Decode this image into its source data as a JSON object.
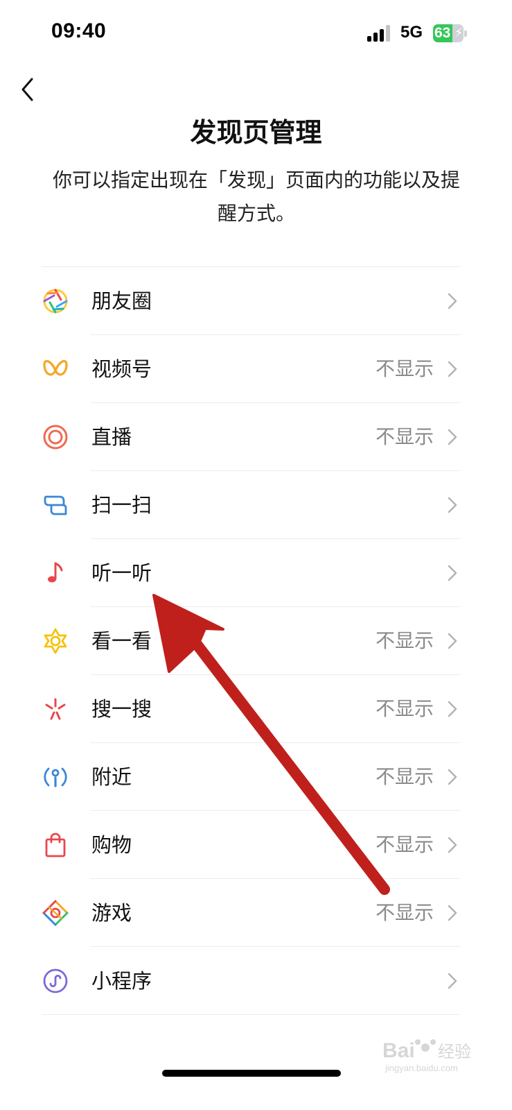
{
  "status_bar": {
    "time": "09:40",
    "network": "5G",
    "battery": "63",
    "battery_level": 0.63
  },
  "header": {
    "title": "发现页管理",
    "description": "你可以指定出现在「发现」页面内的功能以及提醒方式。"
  },
  "items": [
    {
      "label": "朋友圈",
      "status": "",
      "icon": "moments-icon"
    },
    {
      "label": "视频号",
      "status": "不显示",
      "icon": "channels-icon"
    },
    {
      "label": "直播",
      "status": "不显示",
      "icon": "live-icon"
    },
    {
      "label": "扫一扫",
      "status": "",
      "icon": "scan-icon"
    },
    {
      "label": "听一听",
      "status": "",
      "icon": "listen-icon"
    },
    {
      "label": "看一看",
      "status": "不显示",
      "icon": "top-stories-icon"
    },
    {
      "label": "搜一搜",
      "status": "不显示",
      "icon": "search-icon"
    },
    {
      "label": "附近",
      "status": "不显示",
      "icon": "nearby-icon"
    },
    {
      "label": "购物",
      "status": "不显示",
      "icon": "shopping-bag-icon"
    },
    {
      "label": "游戏",
      "status": "不显示",
      "icon": "games-icon"
    },
    {
      "label": "小程序",
      "status": "",
      "icon": "mini-programs-icon"
    }
  ],
  "watermark": {
    "text": "Baidu经验",
    "subtext": "jingyan.baidu.com"
  },
  "colors": {
    "annotation_arrow": "#c0201c",
    "battery_green": "#35c759",
    "secondary_text": "#8a8a8a"
  }
}
